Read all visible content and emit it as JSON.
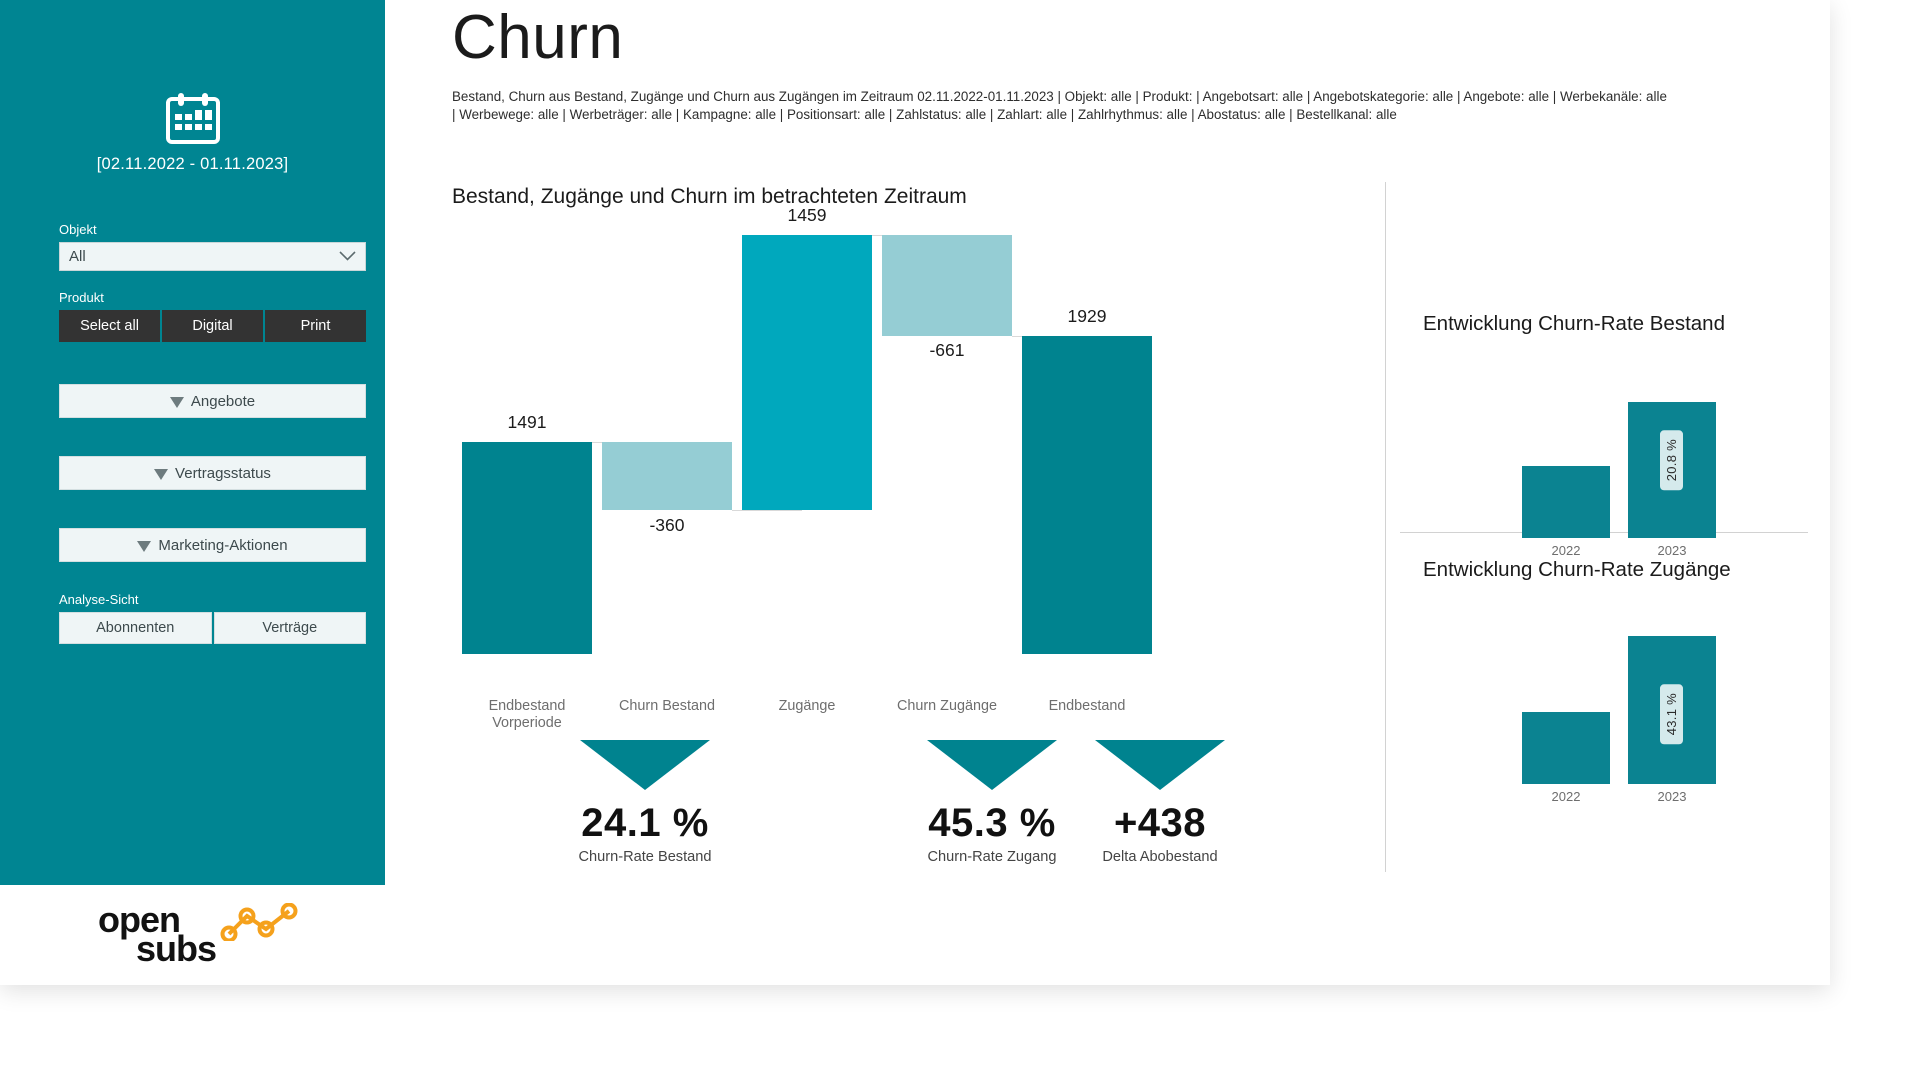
{
  "header": {
    "title": "Churn",
    "subtitle_line1": "Bestand, Churn aus Bestand, Zugänge und Churn aus Zugängen im Zeitraum 02.11.2022-01.11.2023 | Objekt: alle | Produkt: | Angebotsart: alle | Angebotskategorie: alle | Angebote: alle | Werbekanäle: alle",
    "subtitle_line2": "| Werbewege: alle | Werbeträger: alle | Kampagne: alle | Positionsart: alle | Zahlstatus: alle | Zahlart: alle | Zahlrhythmus: alle | Abostatus: alle | Bestellkanal: alle"
  },
  "sidebar": {
    "date_range": "[02.11.2022 - 01.11.2023]",
    "calendar_icon": "calendar-icon",
    "objekt_label": "Objekt",
    "objekt_value": "All",
    "produkt_label": "Produkt",
    "produkt_buttons": [
      "Select all",
      "Digital",
      "Print"
    ],
    "filter_buttons": [
      "Angebote",
      "Vertragsstatus",
      "Marketing-Aktionen"
    ],
    "analyse_label": "Analyse-Sicht",
    "analyse_buttons": [
      "Abonnenten",
      "Verträge"
    ],
    "logo_line1": "open",
    "logo_line2": "subs"
  },
  "colors": {
    "brand_teal": "#008592",
    "bar_dark": "#00838f",
    "bar_light": "#95cdd4",
    "bar_bright": "#00a8bd",
    "dark_button": "#333333",
    "logo_orange": "#f5a11c"
  },
  "chart_data": [
    {
      "type": "bar",
      "title": "Bestand, Zugänge und Churn im betrachteten Zeitraum",
      "subtype": "waterfall",
      "categories": [
        "Endbestand Vorperiode",
        "Churn Bestand",
        "Zugänge",
        "Churn Zugänge",
        "Endbestand"
      ],
      "labels": [
        "1491",
        "-360",
        "1459",
        "-661",
        "1929"
      ],
      "values": [
        1491,
        -360,
        1459,
        -661,
        1929
      ],
      "cumulative_start": [
        0,
        1491,
        1131,
        2590,
        0
      ],
      "cumulative_end": [
        1491,
        1131,
        2590,
        1929,
        1929
      ],
      "bar_colors": [
        "#00838f",
        "#95cdd4",
        "#00a8bd",
        "#95cdd4",
        "#00838f"
      ],
      "xlabel": "",
      "ylabel": "",
      "grid": false,
      "legend": "none"
    },
    {
      "type": "bar",
      "title": "Entwicklung Churn-Rate Bestand",
      "categories": [
        "2022",
        "2023"
      ],
      "values": [
        11.2,
        20.8
      ],
      "data_labels": [
        "",
        "20.8 %"
      ],
      "ylabel": "",
      "grid": false,
      "legend": "none"
    },
    {
      "type": "bar",
      "title": "Entwicklung Churn-Rate Zugänge",
      "categories": [
        "2022",
        "2023"
      ],
      "values": [
        17.5,
        43.1
      ],
      "data_labels": [
        "",
        "43.1 %"
      ],
      "ylabel": "",
      "grid": false,
      "legend": "none"
    }
  ],
  "kpis": [
    {
      "value": "24.1 %",
      "caption": "Churn-Rate Bestand"
    },
    {
      "value": "45.3 %",
      "caption": "Churn-Rate Zugang"
    },
    {
      "value": "+438",
      "caption": "Delta Abobestand"
    }
  ]
}
